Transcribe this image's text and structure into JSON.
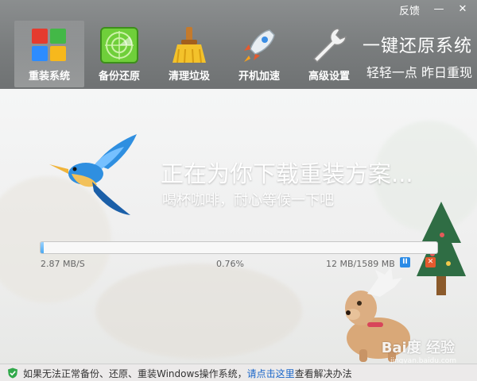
{
  "window": {
    "feedback": "反馈",
    "minimize_glyph": "—",
    "close_glyph": "✕"
  },
  "nav": [
    {
      "label": "重装系统",
      "icon": "windows-logo-icon",
      "active": true
    },
    {
      "label": "备份还原",
      "icon": "radar-icon",
      "active": false
    },
    {
      "label": "清理垃圾",
      "icon": "broom-icon",
      "active": false
    },
    {
      "label": "开机加速",
      "icon": "rocket-icon",
      "active": false
    },
    {
      "label": "高级设置",
      "icon": "wrench-icon",
      "active": false
    }
  ],
  "slogan": {
    "main": "一键还原系统",
    "sub": "轻轻一点  昨日重现"
  },
  "content": {
    "headline": "正在为你下载重装方案...",
    "subline": "喝杯咖啡，耐心等候一下吧",
    "progress": {
      "speed": "2.87 MB/S",
      "percent": "0.76%",
      "percent_value": 0.76,
      "size": "12 MB/1589 MB"
    },
    "pause_glyph": "II",
    "cancel_glyph": "✕"
  },
  "watermark": {
    "brand": "Bai度 经验",
    "url": "jingyan.baidu.com"
  },
  "footer": {
    "text_before": "如果无法正常备份、还原、重装Windows操作系统，",
    "link": "请点击这里",
    "text_after": "查看解决办法"
  },
  "colors": {
    "topbar": "#7b7e7f",
    "progress": "#4aa8f1",
    "link": "#1a66c9",
    "pause": "#2b8be6",
    "cancel": "#e45a2e"
  }
}
